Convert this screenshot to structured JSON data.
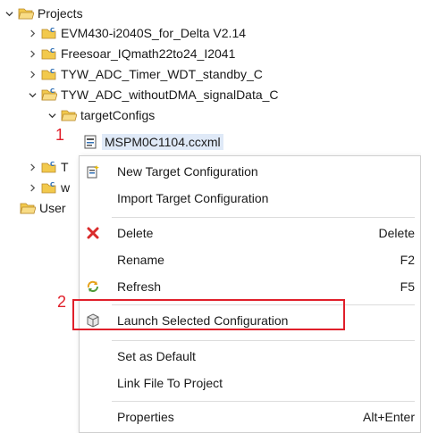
{
  "tree": {
    "root": {
      "label": "Projects"
    },
    "projects": [
      {
        "label": "EVM430-i2040S_for_Delta V2.14"
      },
      {
        "label": "Freesoar_IQmath22to24_I2041"
      },
      {
        "label": "TYW_ADC_Timer_WDT_standby_C"
      },
      {
        "label": "TYW_ADC_withoutDMA_signalData_C"
      }
    ],
    "folder": {
      "label": "targetConfigs"
    },
    "file": {
      "label": "MSPM0C1104.ccxml"
    },
    "partial": [
      {
        "label": "T"
      },
      {
        "label": "w"
      },
      {
        "label": "User"
      }
    ]
  },
  "annotations": {
    "one": "1",
    "two": "2"
  },
  "context_menu": {
    "new_target": "New Target Configuration",
    "import_target": "Import Target Configuration",
    "delete": "Delete",
    "delete_shortcut": "Delete",
    "rename": "Rename",
    "rename_shortcut": "F2",
    "refresh": "Refresh",
    "refresh_shortcut": "F5",
    "launch": "Launch Selected Configuration",
    "set_default": "Set as Default",
    "link_file": "Link File To Project",
    "properties": "Properties",
    "properties_shortcut": "Alt+Enter"
  },
  "colors": {
    "annotation_red": "#e01f2a",
    "selection": "#dfe9f7",
    "folder_yellow": "#f2c94c",
    "project_blue": "#2f6fb5"
  }
}
